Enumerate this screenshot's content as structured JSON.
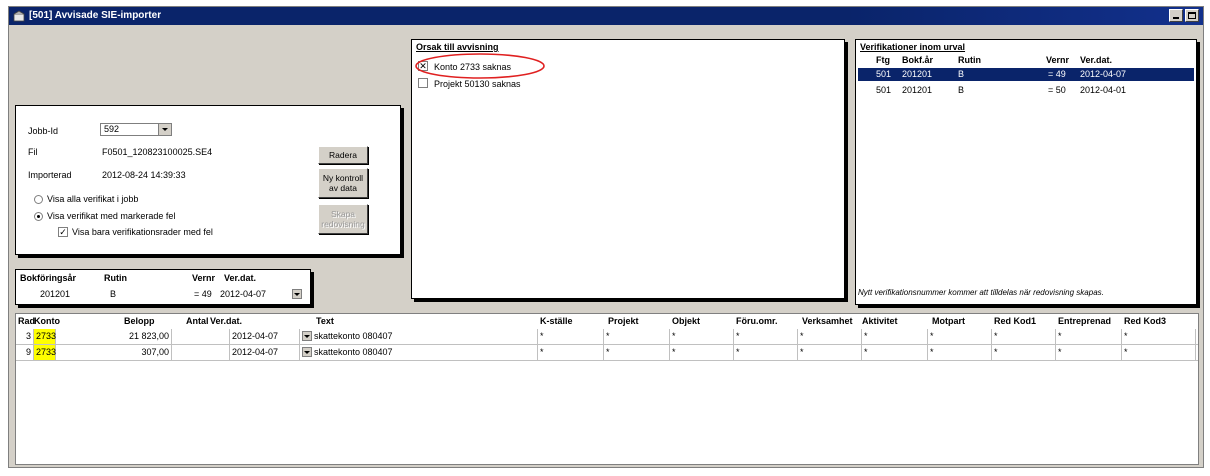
{
  "window": {
    "title": "[501] Avvisade SIE-importer"
  },
  "job": {
    "jobbid_label": "Jobb-Id",
    "jobbid_value": "592",
    "fil_label": "Fil",
    "fil_value": "F0501_120823100025.SE4",
    "importerad_label": "Importerad",
    "importerad_value": "2012-08-24 14:39:33",
    "radio_all": "Visa alla verifikat i jobb",
    "radio_marked": "Visa verifikat med markerade fel",
    "checkbox_rows": "Visa bara verifikationsrader med fel",
    "btn_radera": "Radera",
    "btn_ny_kontroll": "Ny kontroll av data",
    "btn_skapa": "Skapa redovisning"
  },
  "orsak": {
    "title": "Orsak till avvisning",
    "items": [
      "Konto 2733 saknas",
      "Projekt 50130 saknas"
    ]
  },
  "verifikationer": {
    "title": "Verifikationer inom urval",
    "headers": [
      "Ftg",
      "Bokf.år",
      "Rutin",
      "Vernr",
      "Ver.dat."
    ],
    "rows": [
      [
        "501",
        "201201",
        "B",
        "= 49",
        "2012-04-07"
      ],
      [
        "501",
        "201201",
        "B",
        "= 50",
        "2012-04-01"
      ]
    ],
    "footer": "Nytt verifikationsnummer kommer att tilldelas när redovisning skapas."
  },
  "summary": {
    "headers": [
      "Bokföringsår",
      "Rutin",
      "Vernr",
      "Ver.dat."
    ],
    "values": [
      "201201",
      "B",
      "= 49",
      "2012-04-07"
    ]
  },
  "grid": {
    "headers": [
      "Rad",
      "Konto",
      "Belopp",
      "Antal",
      "Ver.dat.",
      "Text",
      "K-ställe",
      "Projekt",
      "Objekt",
      "Föru.omr.",
      "Verksamhet",
      "Aktivitet",
      "Motpart",
      "Red Kod1",
      "Entreprenad",
      "Red Kod3"
    ],
    "rows": [
      {
        "rad": "3",
        "konto": "2733",
        "belopp": "21 823,00",
        "antal": "",
        "verdat": "2012-04-07",
        "text": "skattekonto 080407"
      },
      {
        "rad": "9",
        "konto": "2733",
        "belopp": "307,00",
        "antal": "",
        "verdat": "2012-04-07",
        "text": "skattekonto 080407"
      }
    ],
    "placeholder": "*"
  },
  "colors": {
    "title_bar": "#0a246a",
    "selection": "#0a246a",
    "highlight": "#ffff00",
    "annotation_circle": "#e02020"
  }
}
